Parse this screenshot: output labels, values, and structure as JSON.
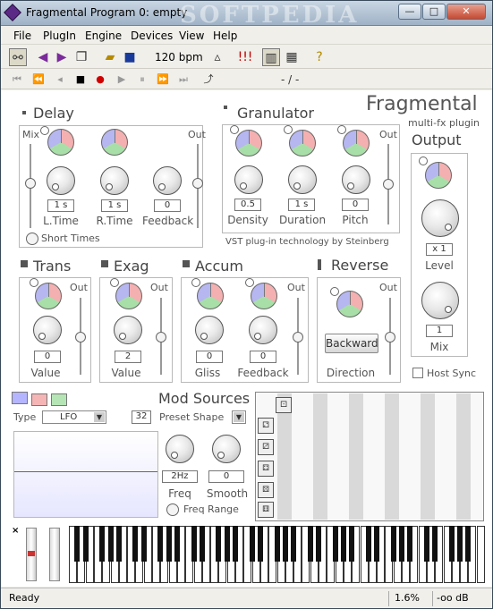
{
  "window": {
    "title": "Fragmental Program 0: empty",
    "watermark": "SOFTPEDIA"
  },
  "menu": [
    "File",
    "PlugIn",
    "Engine",
    "Devices",
    "View",
    "Help"
  ],
  "toolbar": {
    "bpm": "120 bpm"
  },
  "transport": {
    "position": "- / -"
  },
  "brand": {
    "name": "Fragmental",
    "subtitle": "multi-fx plugin",
    "tech": "VST plug-in technology by Steinberg"
  },
  "delay": {
    "title": "Delay",
    "mix": "Mix",
    "out": "Out",
    "ltime_val": "1 s",
    "rtime_val": "1 s",
    "feedback_val": "0",
    "ltime": "L.Time",
    "rtime": "R.Time",
    "feedback": "Feedback",
    "short": "Short Times"
  },
  "granulator": {
    "title": "Granulator",
    "out": "Out",
    "density_val": "0.5",
    "duration_val": "1 s",
    "pitch_val": "0",
    "density": "Density",
    "duration": "Duration",
    "pitch": "Pitch"
  },
  "output": {
    "title": "Output",
    "level_val": "x 1",
    "level": "Level",
    "mix_val": "1",
    "mix": "Mix",
    "hostsync": "Host Sync"
  },
  "trans": {
    "title": "Trans",
    "out": "Out",
    "val": "0",
    "lbl": "Value"
  },
  "exag": {
    "title": "Exag",
    "out": "Out",
    "val": "2",
    "lbl": "Value"
  },
  "accum": {
    "title": "Accum",
    "out": "Out",
    "gliss_val": "0",
    "feedback_val": "0",
    "gliss": "Gliss",
    "feedback": "Feedback"
  },
  "reverse": {
    "title": "Reverse",
    "out": "Out",
    "btn": "Backward",
    "lbl": "Direction"
  },
  "mod": {
    "title": "Mod Sources",
    "type_lbl": "Type",
    "type_val": "LFO",
    "count": "32",
    "preset": "Preset Shape",
    "freq_val": "2Hz",
    "smooth_val": "0",
    "freq": "Freq",
    "smooth": "Smooth",
    "freq_range": "Freq Range"
  },
  "status": {
    "text": "Ready",
    "cpu": "1.6%",
    "level": "-oo dB"
  }
}
